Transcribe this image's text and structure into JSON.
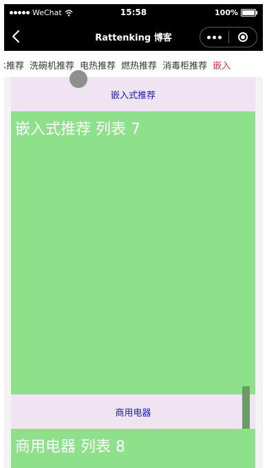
{
  "status_bar": {
    "carrier": "WeChat",
    "time": "15:58",
    "battery": "100%"
  },
  "nav": {
    "title": "Rattenking 博客"
  },
  "tabs": [
    {
      "label": "水推荐",
      "active": false
    },
    {
      "label": "洗碗机推荐",
      "active": false
    },
    {
      "label": "电热推荐",
      "active": false
    },
    {
      "label": "燃热推荐",
      "active": false
    },
    {
      "label": "消毒柜推荐",
      "active": false
    },
    {
      "label": "嵌入",
      "active": true
    }
  ],
  "sections": [
    {
      "header": "嵌入式推荐",
      "list_title": "嵌入式推荐 列表 7"
    },
    {
      "header": "商用电器",
      "list_title": "商用电器 列表 8"
    }
  ],
  "colors": {
    "accent": "#e0303a",
    "section_header_bg": "#f1e4f2",
    "list_bg": "#8fe08a",
    "header_text": "#1a1ab0"
  }
}
